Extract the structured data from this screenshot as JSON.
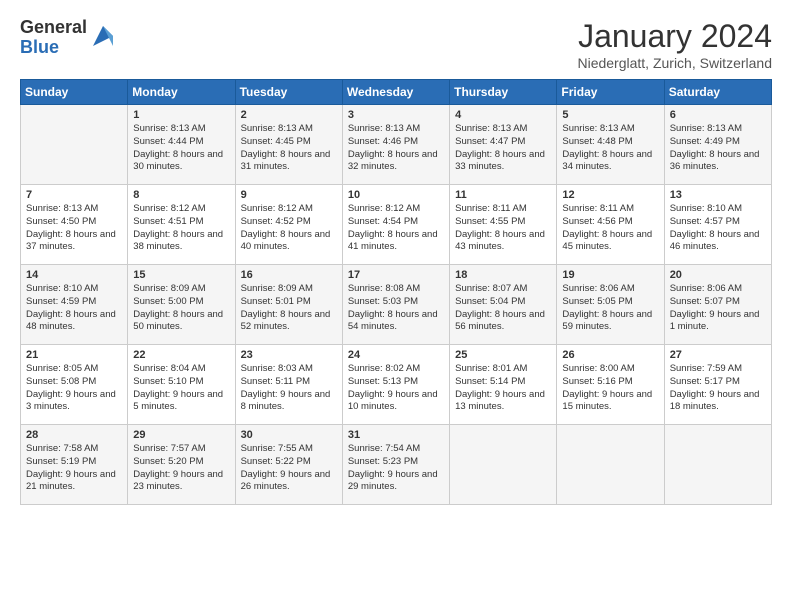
{
  "logo": {
    "general": "General",
    "blue": "Blue"
  },
  "header": {
    "month": "January 2024",
    "location": "Niederglatt, Zurich, Switzerland"
  },
  "weekdays": [
    "Sunday",
    "Monday",
    "Tuesday",
    "Wednesday",
    "Thursday",
    "Friday",
    "Saturday"
  ],
  "weeks": [
    [
      {
        "day": "",
        "sunrise": "",
        "sunset": "",
        "daylight": ""
      },
      {
        "day": "1",
        "sunrise": "Sunrise: 8:13 AM",
        "sunset": "Sunset: 4:44 PM",
        "daylight": "Daylight: 8 hours and 30 minutes."
      },
      {
        "day": "2",
        "sunrise": "Sunrise: 8:13 AM",
        "sunset": "Sunset: 4:45 PM",
        "daylight": "Daylight: 8 hours and 31 minutes."
      },
      {
        "day": "3",
        "sunrise": "Sunrise: 8:13 AM",
        "sunset": "Sunset: 4:46 PM",
        "daylight": "Daylight: 8 hours and 32 minutes."
      },
      {
        "day": "4",
        "sunrise": "Sunrise: 8:13 AM",
        "sunset": "Sunset: 4:47 PM",
        "daylight": "Daylight: 8 hours and 33 minutes."
      },
      {
        "day": "5",
        "sunrise": "Sunrise: 8:13 AM",
        "sunset": "Sunset: 4:48 PM",
        "daylight": "Daylight: 8 hours and 34 minutes."
      },
      {
        "day": "6",
        "sunrise": "Sunrise: 8:13 AM",
        "sunset": "Sunset: 4:49 PM",
        "daylight": "Daylight: 8 hours and 36 minutes."
      }
    ],
    [
      {
        "day": "7",
        "sunrise": "Sunrise: 8:13 AM",
        "sunset": "Sunset: 4:50 PM",
        "daylight": "Daylight: 8 hours and 37 minutes."
      },
      {
        "day": "8",
        "sunrise": "Sunrise: 8:12 AM",
        "sunset": "Sunset: 4:51 PM",
        "daylight": "Daylight: 8 hours and 38 minutes."
      },
      {
        "day": "9",
        "sunrise": "Sunrise: 8:12 AM",
        "sunset": "Sunset: 4:52 PM",
        "daylight": "Daylight: 8 hours and 40 minutes."
      },
      {
        "day": "10",
        "sunrise": "Sunrise: 8:12 AM",
        "sunset": "Sunset: 4:54 PM",
        "daylight": "Daylight: 8 hours and 41 minutes."
      },
      {
        "day": "11",
        "sunrise": "Sunrise: 8:11 AM",
        "sunset": "Sunset: 4:55 PM",
        "daylight": "Daylight: 8 hours and 43 minutes."
      },
      {
        "day": "12",
        "sunrise": "Sunrise: 8:11 AM",
        "sunset": "Sunset: 4:56 PM",
        "daylight": "Daylight: 8 hours and 45 minutes."
      },
      {
        "day": "13",
        "sunrise": "Sunrise: 8:10 AM",
        "sunset": "Sunset: 4:57 PM",
        "daylight": "Daylight: 8 hours and 46 minutes."
      }
    ],
    [
      {
        "day": "14",
        "sunrise": "Sunrise: 8:10 AM",
        "sunset": "Sunset: 4:59 PM",
        "daylight": "Daylight: 8 hours and 48 minutes."
      },
      {
        "day": "15",
        "sunrise": "Sunrise: 8:09 AM",
        "sunset": "Sunset: 5:00 PM",
        "daylight": "Daylight: 8 hours and 50 minutes."
      },
      {
        "day": "16",
        "sunrise": "Sunrise: 8:09 AM",
        "sunset": "Sunset: 5:01 PM",
        "daylight": "Daylight: 8 hours and 52 minutes."
      },
      {
        "day": "17",
        "sunrise": "Sunrise: 8:08 AM",
        "sunset": "Sunset: 5:03 PM",
        "daylight": "Daylight: 8 hours and 54 minutes."
      },
      {
        "day": "18",
        "sunrise": "Sunrise: 8:07 AM",
        "sunset": "Sunset: 5:04 PM",
        "daylight": "Daylight: 8 hours and 56 minutes."
      },
      {
        "day": "19",
        "sunrise": "Sunrise: 8:06 AM",
        "sunset": "Sunset: 5:05 PM",
        "daylight": "Daylight: 8 hours and 59 minutes."
      },
      {
        "day": "20",
        "sunrise": "Sunrise: 8:06 AM",
        "sunset": "Sunset: 5:07 PM",
        "daylight": "Daylight: 9 hours and 1 minute."
      }
    ],
    [
      {
        "day": "21",
        "sunrise": "Sunrise: 8:05 AM",
        "sunset": "Sunset: 5:08 PM",
        "daylight": "Daylight: 9 hours and 3 minutes."
      },
      {
        "day": "22",
        "sunrise": "Sunrise: 8:04 AM",
        "sunset": "Sunset: 5:10 PM",
        "daylight": "Daylight: 9 hours and 5 minutes."
      },
      {
        "day": "23",
        "sunrise": "Sunrise: 8:03 AM",
        "sunset": "Sunset: 5:11 PM",
        "daylight": "Daylight: 9 hours and 8 minutes."
      },
      {
        "day": "24",
        "sunrise": "Sunrise: 8:02 AM",
        "sunset": "Sunset: 5:13 PM",
        "daylight": "Daylight: 9 hours and 10 minutes."
      },
      {
        "day": "25",
        "sunrise": "Sunrise: 8:01 AM",
        "sunset": "Sunset: 5:14 PM",
        "daylight": "Daylight: 9 hours and 13 minutes."
      },
      {
        "day": "26",
        "sunrise": "Sunrise: 8:00 AM",
        "sunset": "Sunset: 5:16 PM",
        "daylight": "Daylight: 9 hours and 15 minutes."
      },
      {
        "day": "27",
        "sunrise": "Sunrise: 7:59 AM",
        "sunset": "Sunset: 5:17 PM",
        "daylight": "Daylight: 9 hours and 18 minutes."
      }
    ],
    [
      {
        "day": "28",
        "sunrise": "Sunrise: 7:58 AM",
        "sunset": "Sunset: 5:19 PM",
        "daylight": "Daylight: 9 hours and 21 minutes."
      },
      {
        "day": "29",
        "sunrise": "Sunrise: 7:57 AM",
        "sunset": "Sunset: 5:20 PM",
        "daylight": "Daylight: 9 hours and 23 minutes."
      },
      {
        "day": "30",
        "sunrise": "Sunrise: 7:55 AM",
        "sunset": "Sunset: 5:22 PM",
        "daylight": "Daylight: 9 hours and 26 minutes."
      },
      {
        "day": "31",
        "sunrise": "Sunrise: 7:54 AM",
        "sunset": "Sunset: 5:23 PM",
        "daylight": "Daylight: 9 hours and 29 minutes."
      },
      {
        "day": "",
        "sunrise": "",
        "sunset": "",
        "daylight": ""
      },
      {
        "day": "",
        "sunrise": "",
        "sunset": "",
        "daylight": ""
      },
      {
        "day": "",
        "sunrise": "",
        "sunset": "",
        "daylight": ""
      }
    ]
  ]
}
